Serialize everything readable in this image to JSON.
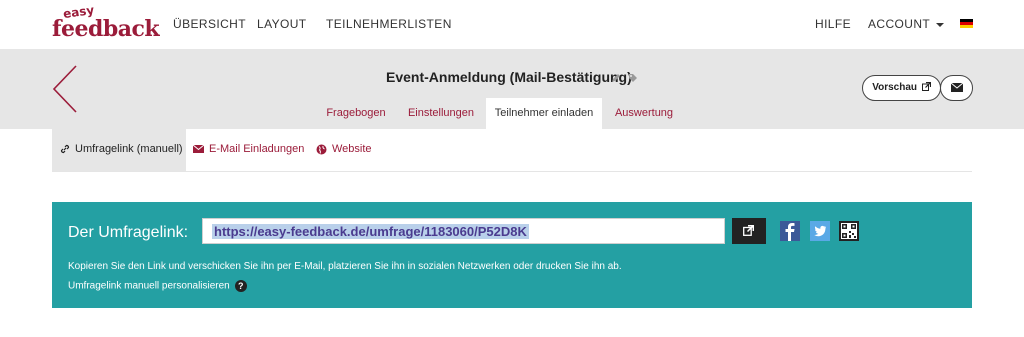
{
  "logo": {
    "top": "easy",
    "bottom": "feedback"
  },
  "nav": {
    "items": [
      "ÜBERSICHT",
      "LAYOUT",
      "TEILNEHMERLISTEN"
    ],
    "help": "HILFE",
    "account": "ACCOUNT",
    "language_flag": "de-flag-icon"
  },
  "survey": {
    "title": "Event-Anmeldung (Mail-Bestätigung)",
    "icons": [
      "pencil-icon",
      "tag-icon"
    ]
  },
  "tabs": [
    {
      "label": "Fragebogen",
      "active": false
    },
    {
      "label": "Einstellungen",
      "active": false
    },
    {
      "label": "Teilnehmer einladen",
      "active": true
    },
    {
      "label": "Auswertung",
      "active": false
    }
  ],
  "actions": {
    "preview": "Vorschau",
    "mail_icon": "envelope-icon"
  },
  "subtabs": [
    {
      "label": "Umfragelink (manuell)",
      "icon": "link-icon",
      "active": true
    },
    {
      "label": "E-Mail Einladungen",
      "icon": "envelope-icon",
      "active": false
    },
    {
      "label": "Website",
      "icon": "globe-icon",
      "active": false
    }
  ],
  "panel": {
    "label": "Der Umfragelink:",
    "url": "https://easy-feedback.de/umfrage/1183060/P52D8K",
    "info": "Kopieren Sie den Link und verschicken Sie ihn per E-Mail, platzieren Sie ihn in sozialen Netzwerken oder drucken Sie ihn ab.",
    "personalize": "Umfragelink manuell personalisieren",
    "help_symbol": "?",
    "social": [
      "facebook-icon",
      "twitter-icon",
      "qr-code-icon"
    ]
  },
  "colors": {
    "brand": "#9b1c3a",
    "panel": "#24a0a3",
    "header_bg": "#e6e6e6"
  }
}
